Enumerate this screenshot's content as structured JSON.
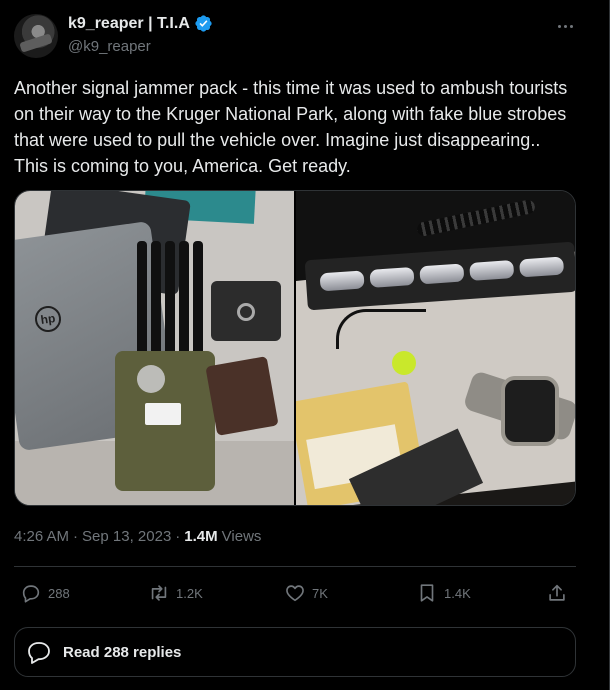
{
  "author": {
    "display_name": "k9_reaper | T.I.A",
    "handle": "@k9_reaper",
    "verified": true,
    "verified_color": "#1d9bf0"
  },
  "tweet": {
    "text": "Another signal jammer pack - this time it was used to ambush tourists on their way to the Kruger National Park, along with fake blue strobes that were used to pull the vehicle over. Imagine just disappearing.. This is coming to you, America. Get ready."
  },
  "meta": {
    "time": "4:26 AM",
    "separator1": "·",
    "date": "Sep 13, 2023",
    "separator2": "·",
    "views_count": "1.4M",
    "views_label": "Views"
  },
  "actions": {
    "reply_count": "288",
    "retweet_count": "1.2K",
    "like_count": "7K",
    "bookmark_count": "1.4K"
  },
  "read_replies": {
    "label": "Read 288 replies"
  },
  "icons": {
    "more": "more-horizontal-icon",
    "reply": "reply-icon",
    "retweet": "retweet-icon",
    "like": "heart-icon",
    "bookmark": "bookmark-icon",
    "share": "share-icon",
    "replies": "speech-bubble-icon"
  },
  "colors": {
    "background": "#000000",
    "text": "#e7e9ea",
    "muted": "#71767b",
    "border": "#2f3336"
  }
}
